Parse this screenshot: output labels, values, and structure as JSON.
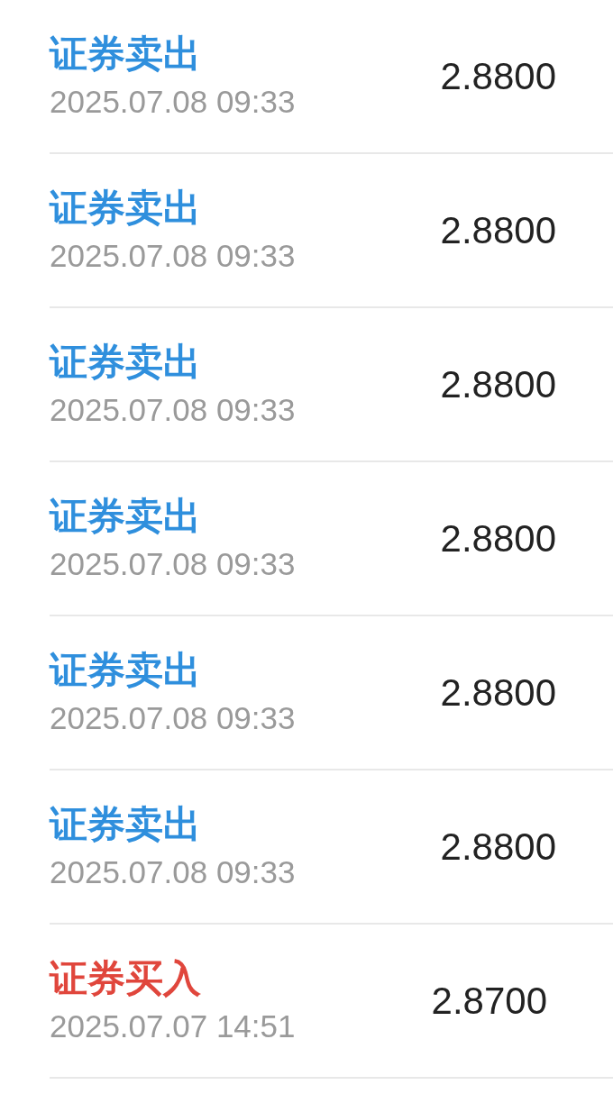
{
  "trades": [
    {
      "kind": "sell",
      "title": "证券卖出",
      "time": "2025.07.08 09:33",
      "price": "2.8800"
    },
    {
      "kind": "sell",
      "title": "证券卖出",
      "time": "2025.07.08 09:33",
      "price": "2.8800"
    },
    {
      "kind": "sell",
      "title": "证券卖出",
      "time": "2025.07.08 09:33",
      "price": "2.8800"
    },
    {
      "kind": "sell",
      "title": "证券卖出",
      "time": "2025.07.08 09:33",
      "price": "2.8800"
    },
    {
      "kind": "sell",
      "title": "证券卖出",
      "time": "2025.07.08 09:33",
      "price": "2.8800"
    },
    {
      "kind": "sell",
      "title": "证券卖出",
      "time": "2025.07.08 09:33",
      "price": "2.8800"
    },
    {
      "kind": "buy",
      "title": "证券买入",
      "time": "2025.07.07 14:51",
      "price": "2.8700"
    }
  ]
}
